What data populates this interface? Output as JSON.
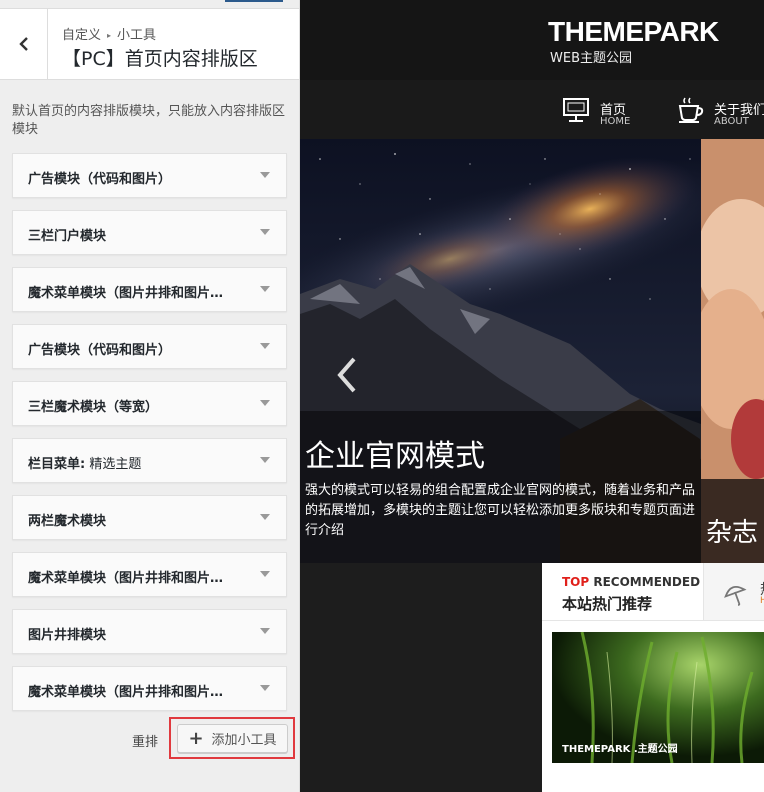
{
  "panel": {
    "breadcrumb_parent": "自定义",
    "breadcrumb_current": "小工具",
    "title": "【PC】首页内容排版区",
    "description": "默认首页的内容排版模块，只能放入内容排版区模块",
    "widgets": [
      {
        "label": "广告模块（代码和图片）",
        "sub": ""
      },
      {
        "label": "三栏门户模块",
        "sub": ""
      },
      {
        "label": "魔术菜单模块（图片井排和图片…",
        "sub": ""
      },
      {
        "label": "广告模块（代码和图片）",
        "sub": ""
      },
      {
        "label": "三栏魔术模块（等宽）",
        "sub": ""
      },
      {
        "label": "栏目菜单:",
        "sub": " 精选主题"
      },
      {
        "label": "两栏魔术模块",
        "sub": ""
      },
      {
        "label": "魔术菜单模块（图片井排和图片…",
        "sub": ""
      },
      {
        "label": "图片井排模块",
        "sub": ""
      },
      {
        "label": "魔术菜单模块（图片井排和图片…",
        "sub": ""
      }
    ],
    "reorder_label": "重排",
    "add_widget_label": "添加小工具"
  },
  "preview": {
    "logo": "THEMEPARK",
    "logo_sub": "WEB主题公园",
    "nav": [
      {
        "title": "首页",
        "subtitle": "HOME",
        "icon": "monitor-icon"
      },
      {
        "title": "关于我们",
        "subtitle": "ABOUT",
        "icon": "coffee-cup-icon"
      }
    ],
    "slide_title": "企业官网模式",
    "slide_text": "强大的模式可以轻易的组合配置成企业官网的模式，随着业务和产品的拓展增加，多模块的主题让您可以轻松添加更多版块和专题页面进行介绍",
    "slide2_title": "杂志",
    "recommend": {
      "top_red": "TOP",
      "top_rest": " RECOMMENDED",
      "title_cn": "本站热门推荐",
      "tab_title": "热",
      "tab_sub": "H"
    },
    "thumb_label": "THEMEPARK .主题公园"
  },
  "colors": {
    "accent_blue": "#2c5a8c",
    "highlight_red": "#e0393e",
    "recommend_red": "#e0201b"
  }
}
